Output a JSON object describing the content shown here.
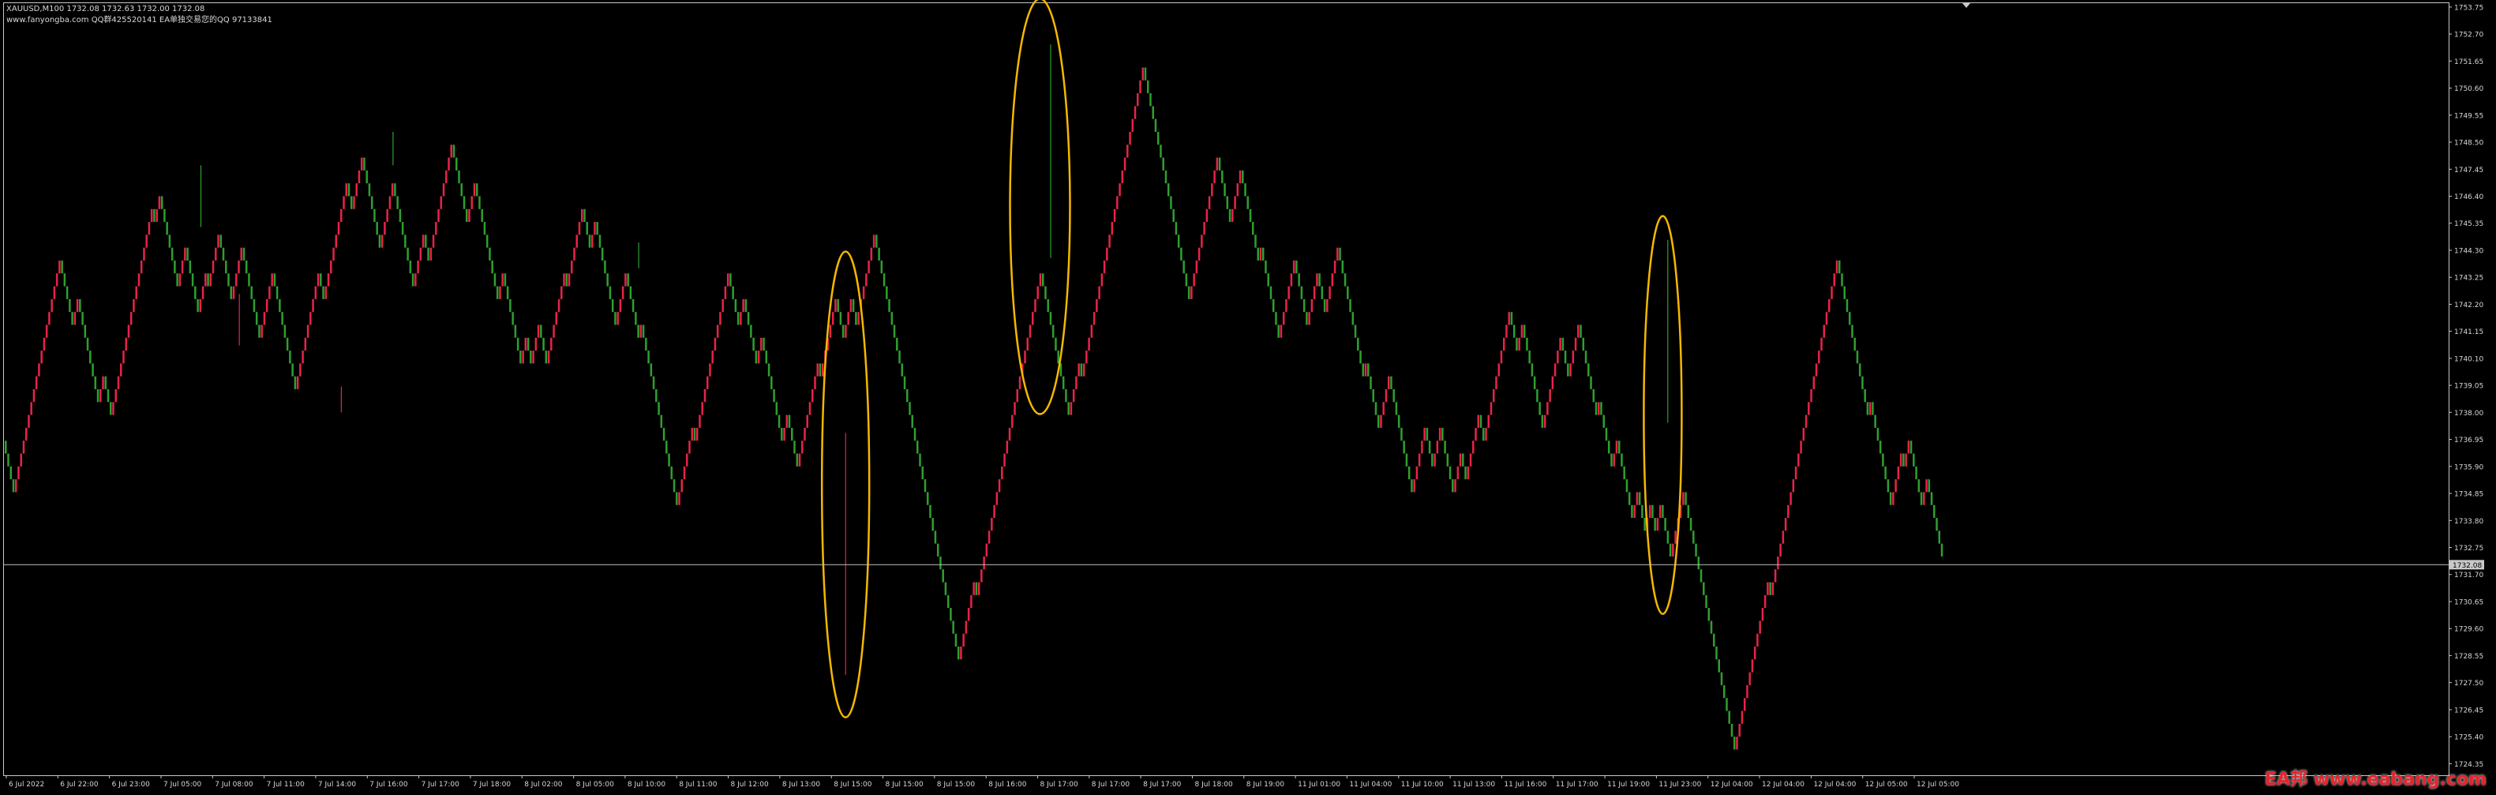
{
  "header": {
    "symbol_line": "XAUUSD,M100  1732.08  1732.63  1732.00  1732.08",
    "site_line": "www.fanyongba.com    QQ群425520141   EA单独交易您的QQ 97133841"
  },
  "watermark": "EA邦 www.eabang.com",
  "colors": {
    "background": "#000000",
    "bull": "#e8234a",
    "bear": "#2ea02e",
    "axis": "#c8c8c8",
    "text": "#d8d8d8",
    "highlight": "#f5b800",
    "price_line": "#c0c0c0"
  },
  "chart_data": {
    "type": "bar",
    "title": "XAUUSD,M100",
    "current_price": "1732.08",
    "current_price_value": 1732.08,
    "ylim": [
      1723.9,
      1753.9
    ],
    "y_ticks": [
      "1753.75",
      "1752.70",
      "1751.65",
      "1750.60",
      "1749.55",
      "1748.50",
      "1747.45",
      "1746.40",
      "1745.35",
      "1744.30",
      "1743.25",
      "1742.20",
      "1741.15",
      "1740.10",
      "1739.05",
      "1738.00",
      "1736.95",
      "1735.90",
      "1734.85",
      "1733.80",
      "1732.75",
      "1731.70",
      "1730.65",
      "1729.60",
      "1728.55",
      "1727.50",
      "1726.45",
      "1725.40",
      "1724.35"
    ],
    "x_ticks": [
      "6 Jul 2022",
      "6 Jul 22:00",
      "6 Jul 23:00",
      "7 Jul 05:00",
      "7 Jul 08:00",
      "7 Jul 11:00",
      "7 Jul 14:00",
      "7 Jul 16:00",
      "7 Jul 17:00",
      "7 Jul 18:00",
      "8 Jul 02:00",
      "8 Jul 05:00",
      "8 Jul 10:00",
      "8 Jul 11:00",
      "8 Jul 12:00",
      "8 Jul 13:00",
      "8 Jul 15:00",
      "8 Jul 15:00",
      "8 Jul 15:00",
      "8 Jul 16:00",
      "8 Jul 17:00",
      "8 Jul 17:00",
      "8 Jul 17:00",
      "8 Jul 18:00",
      "8 Jul 19:00",
      "11 Jul 01:00",
      "11 Jul 04:00",
      "11 Jul 10:00",
      "11 Jul 13:00",
      "11 Jul 16:00",
      "11 Jul 17:00",
      "11 Jul 19:00",
      "11 Jul 23:00",
      "12 Jul 04:00",
      "12 Jul 04:00",
      "12 Jul 04:00",
      "12 Jul 05:00",
      "12 Jul 05:00"
    ],
    "brick_size": 0.5,
    "path_start": 1736.9,
    "path": [
      [
        1734.9,
        "d"
      ],
      [
        1737.6,
        "u"
      ],
      [
        1738.0,
        "d"
      ],
      [
        1744.1,
        "u"
      ],
      [
        1741.1,
        "d"
      ],
      [
        1742.6,
        "u"
      ],
      [
        1738.1,
        "d"
      ],
      [
        1739.6,
        "u"
      ],
      [
        1737.6,
        "d"
      ],
      [
        1746.1,
        "u"
      ],
      [
        1745.1,
        "d"
      ],
      [
        1746.6,
        "u"
      ],
      [
        1742.6,
        "d"
      ],
      [
        1744.6,
        "u"
      ],
      [
        1741.6,
        "d"
      ],
      [
        1743.6,
        "u"
      ],
      [
        1742.6,
        "d"
      ],
      [
        1745.1,
        "u"
      ],
      [
        1742.1,
        "d"
      ],
      [
        1744.6,
        "u"
      ],
      [
        1740.6,
        "d"
      ],
      [
        1743.6,
        "u"
      ],
      [
        1738.6,
        "d"
      ],
      [
        1743.6,
        "u"
      ],
      [
        1742.1,
        "d"
      ],
      [
        1747.1,
        "u"
      ],
      [
        1745.6,
        "d"
      ],
      [
        1748.1,
        "u"
      ],
      [
        1744.1,
        "d"
      ],
      [
        1747.1,
        "u"
      ],
      [
        1742.6,
        "d"
      ],
      [
        1745.1,
        "u"
      ],
      [
        1743.6,
        "d"
      ],
      [
        1748.6,
        "u"
      ],
      [
        1745.1,
        "d"
      ],
      [
        1747.1,
        "u"
      ],
      [
        1742.1,
        "d"
      ],
      [
        1743.6,
        "u"
      ],
      [
        1739.6,
        "d"
      ],
      [
        1741.1,
        "u"
      ],
      [
        1739.6,
        "d"
      ],
      [
        1741.6,
        "u"
      ],
      [
        1739.6,
        "d"
      ],
      [
        1743.6,
        "u"
      ],
      [
        1742.6,
        "d"
      ],
      [
        1746.1,
        "u"
      ],
      [
        1744.1,
        "d"
      ],
      [
        1745.6,
        "u"
      ],
      [
        1741.1,
        "d"
      ],
      [
        1743.6,
        "u"
      ],
      [
        1740.6,
        "d"
      ],
      [
        1741.6,
        "u"
      ],
      [
        1734.1,
        "d"
      ],
      [
        1737.6,
        "u"
      ],
      [
        1736.6,
        "d"
      ],
      [
        1743.6,
        "u"
      ],
      [
        1741.1,
        "d"
      ],
      [
        1742.6,
        "u"
      ],
      [
        1739.6,
        "d"
      ],
      [
        1741.1,
        "u"
      ],
      [
        1736.6,
        "d"
      ],
      [
        1738.1,
        "u"
      ],
      [
        1735.6,
        "d"
      ],
      [
        1740.1,
        "u"
      ],
      [
        1739.1,
        "d"
      ],
      [
        1742.6,
        "u"
      ],
      [
        1740.6,
        "d"
      ],
      [
        1742.6,
        "u"
      ],
      [
        1741.1,
        "d"
      ],
      [
        1745.1,
        "u"
      ],
      [
        1728.1,
        "d"
      ],
      [
        1731.6,
        "u"
      ],
      [
        1730.6,
        "d"
      ],
      [
        1743.6,
        "u"
      ],
      [
        1742.6,
        "d"
      ],
      [
        1737.6,
        "d"
      ],
      [
        1740.1,
        "u"
      ],
      [
        1739.1,
        "d"
      ],
      [
        1751.6,
        "u"
      ],
      [
        1742.6,
        "d"
      ],
      [
        1743.1,
        "u"
      ],
      [
        1742.1,
        "d"
      ],
      [
        1748.1,
        "u"
      ],
      [
        1745.1,
        "d"
      ],
      [
        1747.6,
        "u"
      ],
      [
        1743.6,
        "d"
      ],
      [
        1744.6,
        "u"
      ],
      [
        1740.6,
        "d"
      ],
      [
        1744.1,
        "u"
      ],
      [
        1741.1,
        "d"
      ],
      [
        1743.6,
        "u"
      ],
      [
        1741.6,
        "d"
      ],
      [
        1744.6,
        "u"
      ],
      [
        1741.6,
        "d"
      ],
      [
        1742.1,
        "u"
      ],
      [
        1739.1,
        "d"
      ],
      [
        1740.1,
        "u"
      ],
      [
        1737.1,
        "d"
      ],
      [
        1739.6,
        "u"
      ],
      [
        1734.6,
        "d"
      ],
      [
        1737.6,
        "u"
      ],
      [
        1735.6,
        "d"
      ],
      [
        1737.6,
        "u"
      ],
      [
        1734.6,
        "d"
      ],
      [
        1736.6,
        "u"
      ],
      [
        1735.1,
        "d"
      ],
      [
        1738.1,
        "u"
      ],
      [
        1736.6,
        "d"
      ],
      [
        1742.1,
        "u"
      ],
      [
        1740.1,
        "d"
      ],
      [
        1741.6,
        "u"
      ],
      [
        1737.1,
        "d"
      ],
      [
        1741.1,
        "u"
      ],
      [
        1739.1,
        "d"
      ],
      [
        1741.6,
        "u"
      ],
      [
        1737.6,
        "d"
      ],
      [
        1738.6,
        "u"
      ],
      [
        1735.6,
        "d"
      ],
      [
        1737.1,
        "u"
      ],
      [
        1733.6,
        "d"
      ],
      [
        1735.1,
        "u"
      ],
      [
        1733.1,
        "d"
      ],
      [
        1734.6,
        "u"
      ],
      [
        1733.1,
        "d"
      ],
      [
        1734.6,
        "u"
      ],
      [
        1732.1,
        "d"
      ],
      [
        1735.1,
        "u"
      ],
      [
        1731.6,
        "d"
      ],
      [
        1732.1,
        "u"
      ],
      [
        1724.6,
        "d"
      ],
      [
        1731.6,
        "u"
      ],
      [
        1730.6,
        "d"
      ],
      [
        1738.6,
        "u"
      ],
      [
        1738.1,
        "d"
      ],
      [
        1744.1,
        "u"
      ],
      [
        1737.6,
        "d"
      ],
      [
        1738.6,
        "u"
      ],
      [
        1734.1,
        "d"
      ],
      [
        1736.6,
        "u"
      ],
      [
        1735.6,
        "d"
      ],
      [
        1737.1,
        "u"
      ],
      [
        1734.1,
        "d"
      ],
      [
        1735.6,
        "u"
      ],
      [
        1732.1,
        "d"
      ]
    ],
    "annotations": [
      {
        "type": "ellipse",
        "center": [
          "8 Jul 13:00",
          1735.2
        ],
        "note": "long downward spike"
      },
      {
        "type": "ellipse",
        "center": [
          "8 Jul 16:00",
          1746.0
        ],
        "note": "long upward spike"
      },
      {
        "type": "ellipse",
        "center": [
          "11 Jul 19:00",
          1737.9
        ],
        "note": "long upward spike"
      }
    ]
  }
}
